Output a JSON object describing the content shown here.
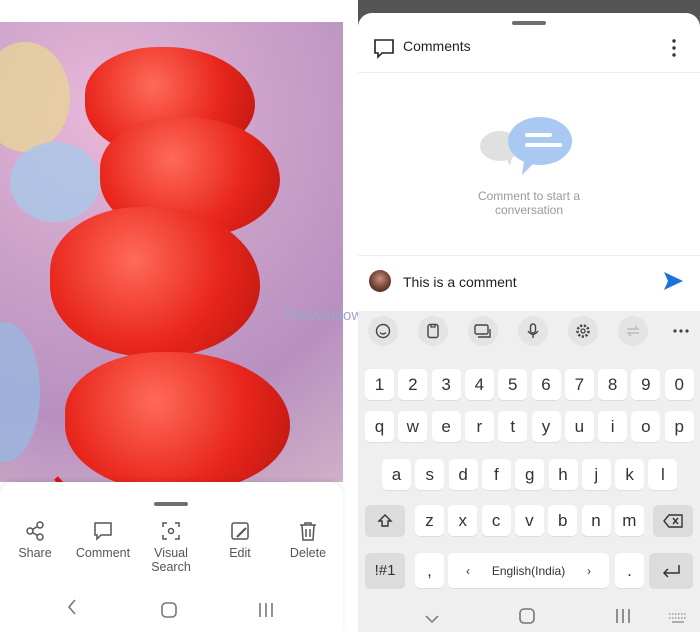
{
  "watermark": "TheWindowsClub",
  "left": {
    "actions": [
      {
        "label": "Share",
        "icon": "share-icon"
      },
      {
        "label": "Comment",
        "icon": "comment-icon"
      },
      {
        "label": "Visual Search",
        "icon": "visual-search-icon"
      },
      {
        "label": "Edit",
        "icon": "edit-icon"
      },
      {
        "label": "Delete",
        "icon": "trash-icon"
      }
    ]
  },
  "comments": {
    "title": "Comments",
    "empty_text": "Comment to start a conversation",
    "input_value": "This is a comment",
    "accent": "#1a73d9"
  },
  "keyboard": {
    "rows": [
      [
        "1",
        "2",
        "3",
        "4",
        "5",
        "6",
        "7",
        "8",
        "9",
        "0"
      ],
      [
        "q",
        "w",
        "e",
        "r",
        "t",
        "y",
        "u",
        "i",
        "o",
        "p"
      ],
      [
        "a",
        "s",
        "d",
        "f",
        "g",
        "h",
        "j",
        "k",
        "l"
      ],
      [
        "z",
        "x",
        "c",
        "v",
        "b",
        "n",
        "m"
      ]
    ],
    "symbols": "!#1",
    "comma": ",",
    "period": ".",
    "language": "English(India)",
    "lang_prev": "‹",
    "lang_next": "›"
  }
}
